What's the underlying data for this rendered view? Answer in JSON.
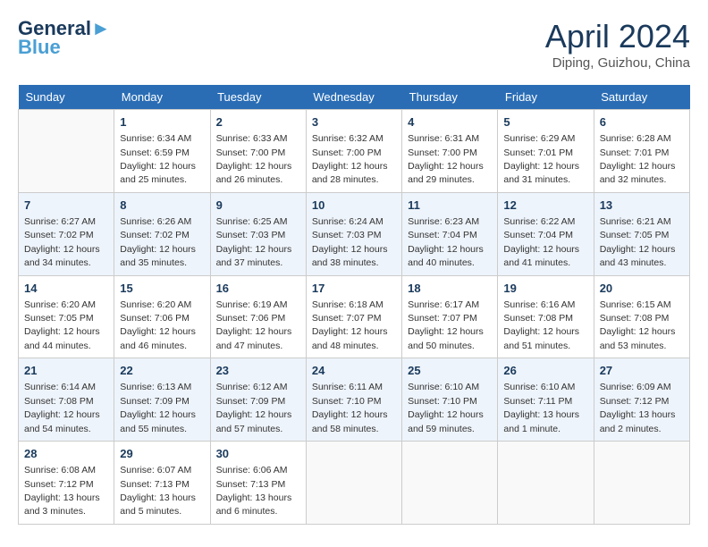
{
  "header": {
    "logo_line1": "General",
    "logo_line2": "Blue",
    "month_title": "April 2024",
    "location": "Diping, Guizhou, China"
  },
  "weekdays": [
    "Sunday",
    "Monday",
    "Tuesday",
    "Wednesday",
    "Thursday",
    "Friday",
    "Saturday"
  ],
  "weeks": [
    [
      {
        "day": "",
        "empty": true
      },
      {
        "day": "1",
        "sunrise": "6:34 AM",
        "sunset": "6:59 PM",
        "daylight": "12 hours and 25 minutes."
      },
      {
        "day": "2",
        "sunrise": "6:33 AM",
        "sunset": "7:00 PM",
        "daylight": "12 hours and 26 minutes."
      },
      {
        "day": "3",
        "sunrise": "6:32 AM",
        "sunset": "7:00 PM",
        "daylight": "12 hours and 28 minutes."
      },
      {
        "day": "4",
        "sunrise": "6:31 AM",
        "sunset": "7:00 PM",
        "daylight": "12 hours and 29 minutes."
      },
      {
        "day": "5",
        "sunrise": "6:29 AM",
        "sunset": "7:01 PM",
        "daylight": "12 hours and 31 minutes."
      },
      {
        "day": "6",
        "sunrise": "6:28 AM",
        "sunset": "7:01 PM",
        "daylight": "12 hours and 32 minutes."
      }
    ],
    [
      {
        "day": "7",
        "sunrise": "6:27 AM",
        "sunset": "7:02 PM",
        "daylight": "12 hours and 34 minutes."
      },
      {
        "day": "8",
        "sunrise": "6:26 AM",
        "sunset": "7:02 PM",
        "daylight": "12 hours and 35 minutes."
      },
      {
        "day": "9",
        "sunrise": "6:25 AM",
        "sunset": "7:03 PM",
        "daylight": "12 hours and 37 minutes."
      },
      {
        "day": "10",
        "sunrise": "6:24 AM",
        "sunset": "7:03 PM",
        "daylight": "12 hours and 38 minutes."
      },
      {
        "day": "11",
        "sunrise": "6:23 AM",
        "sunset": "7:04 PM",
        "daylight": "12 hours and 40 minutes."
      },
      {
        "day": "12",
        "sunrise": "6:22 AM",
        "sunset": "7:04 PM",
        "daylight": "12 hours and 41 minutes."
      },
      {
        "day": "13",
        "sunrise": "6:21 AM",
        "sunset": "7:05 PM",
        "daylight": "12 hours and 43 minutes."
      }
    ],
    [
      {
        "day": "14",
        "sunrise": "6:20 AM",
        "sunset": "7:05 PM",
        "daylight": "12 hours and 44 minutes."
      },
      {
        "day": "15",
        "sunrise": "6:20 AM",
        "sunset": "7:06 PM",
        "daylight": "12 hours and 46 minutes."
      },
      {
        "day": "16",
        "sunrise": "6:19 AM",
        "sunset": "7:06 PM",
        "daylight": "12 hours and 47 minutes."
      },
      {
        "day": "17",
        "sunrise": "6:18 AM",
        "sunset": "7:07 PM",
        "daylight": "12 hours and 48 minutes."
      },
      {
        "day": "18",
        "sunrise": "6:17 AM",
        "sunset": "7:07 PM",
        "daylight": "12 hours and 50 minutes."
      },
      {
        "day": "19",
        "sunrise": "6:16 AM",
        "sunset": "7:08 PM",
        "daylight": "12 hours and 51 minutes."
      },
      {
        "day": "20",
        "sunrise": "6:15 AM",
        "sunset": "7:08 PM",
        "daylight": "12 hours and 53 minutes."
      }
    ],
    [
      {
        "day": "21",
        "sunrise": "6:14 AM",
        "sunset": "7:08 PM",
        "daylight": "12 hours and 54 minutes."
      },
      {
        "day": "22",
        "sunrise": "6:13 AM",
        "sunset": "7:09 PM",
        "daylight": "12 hours and 55 minutes."
      },
      {
        "day": "23",
        "sunrise": "6:12 AM",
        "sunset": "7:09 PM",
        "daylight": "12 hours and 57 minutes."
      },
      {
        "day": "24",
        "sunrise": "6:11 AM",
        "sunset": "7:10 PM",
        "daylight": "12 hours and 58 minutes."
      },
      {
        "day": "25",
        "sunrise": "6:10 AM",
        "sunset": "7:10 PM",
        "daylight": "12 hours and 59 minutes."
      },
      {
        "day": "26",
        "sunrise": "6:10 AM",
        "sunset": "7:11 PM",
        "daylight": "13 hours and 1 minute."
      },
      {
        "day": "27",
        "sunrise": "6:09 AM",
        "sunset": "7:12 PM",
        "daylight": "13 hours and 2 minutes."
      }
    ],
    [
      {
        "day": "28",
        "sunrise": "6:08 AM",
        "sunset": "7:12 PM",
        "daylight": "13 hours and 3 minutes."
      },
      {
        "day": "29",
        "sunrise": "6:07 AM",
        "sunset": "7:13 PM",
        "daylight": "13 hours and 5 minutes."
      },
      {
        "day": "30",
        "sunrise": "6:06 AM",
        "sunset": "7:13 PM",
        "daylight": "13 hours and 6 minutes."
      },
      {
        "day": "",
        "empty": true
      },
      {
        "day": "",
        "empty": true
      },
      {
        "day": "",
        "empty": true
      },
      {
        "day": "",
        "empty": true
      }
    ]
  ]
}
